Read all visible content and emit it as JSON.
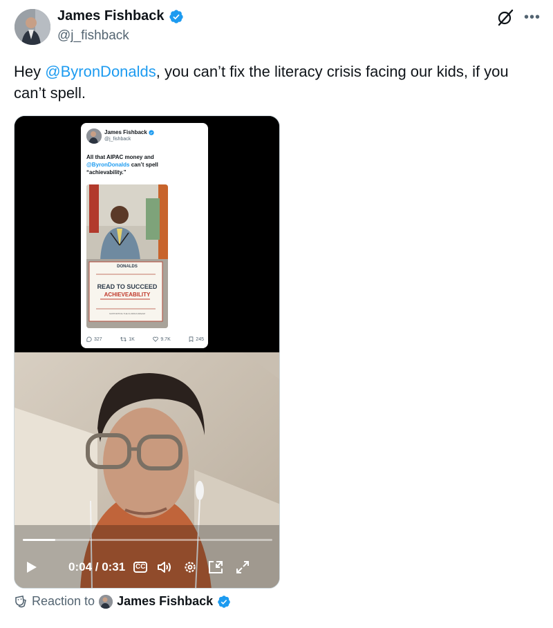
{
  "author": {
    "name": "James Fishback",
    "handle": "@j_fishback",
    "verified": true
  },
  "icons": {
    "grok": "grok-icon",
    "more": "more-icon"
  },
  "tweet": {
    "text_before": "Hey ",
    "mention": "@ByronDonalds",
    "text_after": ", you can’t fix the literacy crisis facing our kids, if you can’t spell."
  },
  "embedded_post": {
    "name": "James Fishback",
    "handle": "@j_fishback",
    "text_line1": "All that AIPAC money and",
    "mention": "@ByronDonalds",
    "text_line2_rest": " can’t spell",
    "text_line3": "“achievability.”",
    "sign_brand": "DONALDS",
    "sign_title": "READ TO SUCCEED",
    "sign_subtitle": "ACHIEVEABILITY",
    "sign_footer": "SUPPORTING THE FLORIDA DREAM",
    "stats": {
      "replies": "327",
      "reposts": "1K",
      "likes": "9.7K",
      "bookmarks": "245"
    }
  },
  "video": {
    "current_time": "0:04",
    "duration": "0:31",
    "time_display": "0:04 / 0:31",
    "progress": 0.129,
    "cc_label": "CC"
  },
  "reaction": {
    "label": "Reaction to",
    "name": "James Fishback"
  },
  "colors": {
    "accent": "#1d9bf0",
    "text": "#0f1419",
    "secondary": "#536471"
  }
}
